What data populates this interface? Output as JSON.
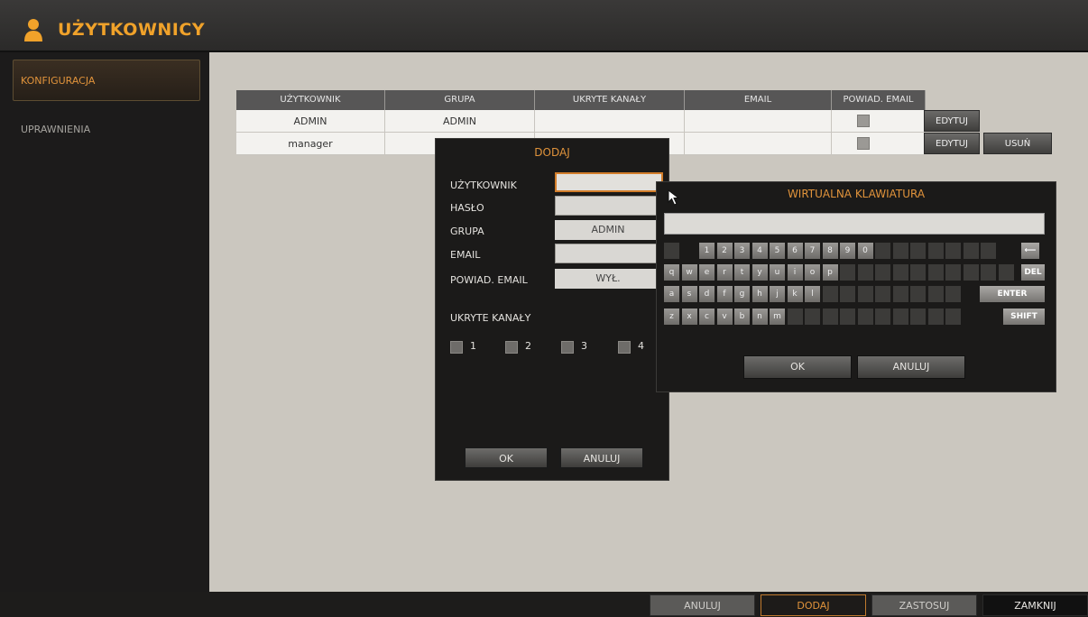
{
  "app": {
    "title": "UŻYTKOWNICY",
    "icon": "user-icon"
  },
  "sidebar": {
    "items": [
      {
        "label": "KONFIGURACJA",
        "active": true
      },
      {
        "label": "UPRAWNIENIA",
        "active": false
      }
    ]
  },
  "table": {
    "headers": [
      "UŻYTKOWNIK",
      "GRUPA",
      "UKRYTE KANAŁY",
      "EMAIL",
      "POWIAD. EMAIL"
    ],
    "rows": [
      {
        "user": "ADMIN",
        "group": "ADMIN",
        "hidden": "",
        "email": "",
        "edit": "EDYTUJ"
      },
      {
        "user": "manager",
        "group": "",
        "hidden": "",
        "email": "",
        "edit": "EDYTUJ",
        "delete": "USUŃ"
      }
    ]
  },
  "dodaj_dialog": {
    "title": "DODAJ",
    "labels": {
      "user": "UŻYTKOWNIK",
      "password": "HASŁO",
      "group": "GRUPA",
      "email": "EMAIL",
      "email_notify": "POWIAD. EMAIL",
      "hidden_channels": "UKRYTE KANAŁY"
    },
    "group_value": "ADMIN",
    "notify_value": "WYŁ.",
    "channels": [
      "1",
      "2",
      "3",
      "4"
    ],
    "ok": "OK",
    "cancel": "ANULUJ"
  },
  "keyboard": {
    "title": "WIRTUALNA KLAWIATURA",
    "row1": [
      "1",
      "2",
      "3",
      "4",
      "5",
      "6",
      "7",
      "8",
      "9",
      "0"
    ],
    "row2": [
      "q",
      "w",
      "e",
      "r",
      "t",
      "y",
      "u",
      "i",
      "o",
      "p"
    ],
    "row3": [
      "a",
      "s",
      "d",
      "f",
      "g",
      "h",
      "j",
      "k",
      "l"
    ],
    "row4": [
      "z",
      "x",
      "c",
      "v",
      "b",
      "n",
      "m"
    ],
    "del": "DEL",
    "enter": "ENTER",
    "shift": "SHIFT",
    "ok": "OK",
    "cancel": "ANULUJ"
  },
  "bottom": {
    "cancel": "ANULUJ",
    "add": "DODAJ",
    "apply": "ZASTOSUJ",
    "close": "ZAMKNIJ"
  },
  "colors": {
    "accent": "#e0933b",
    "panel": "#1b1a19",
    "content_bg": "#cbc7bf"
  }
}
